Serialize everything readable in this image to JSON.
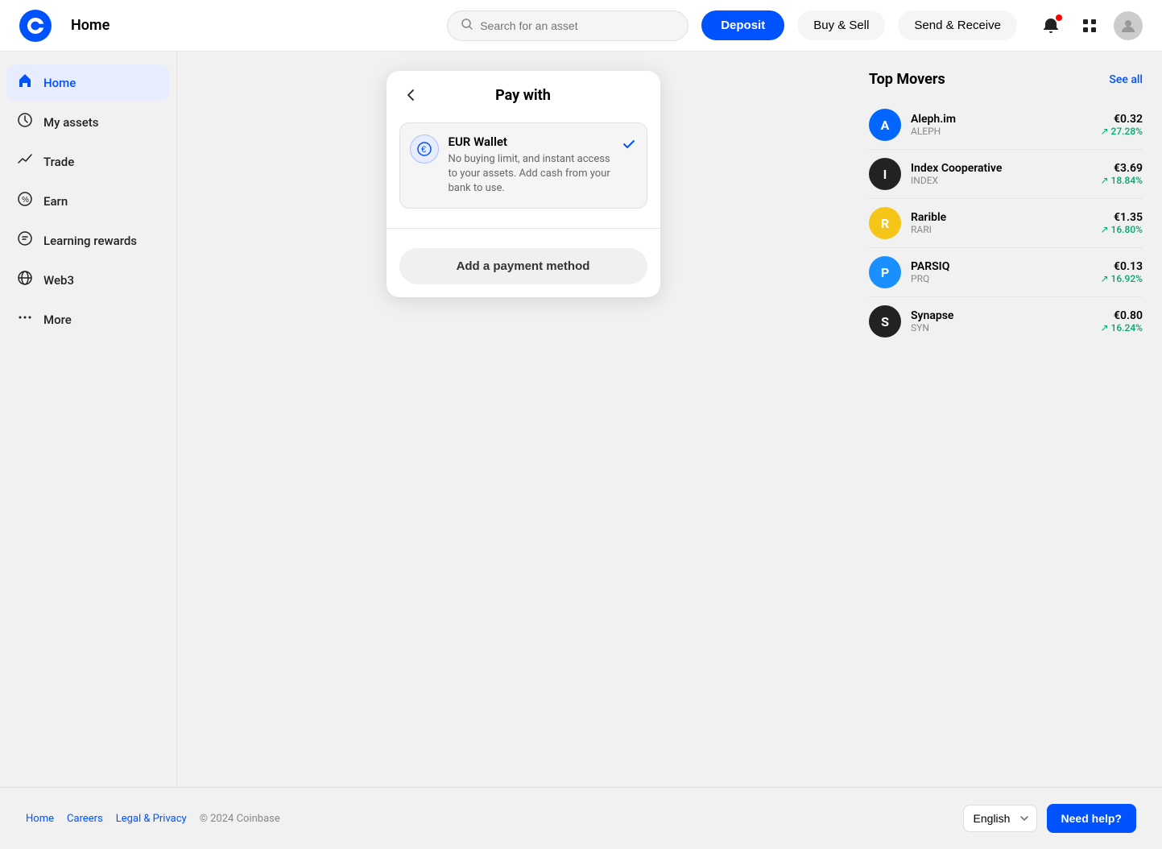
{
  "topnav": {
    "title": "Home",
    "search_placeholder": "Search for an asset",
    "deposit_label": "Deposit",
    "buy_sell_label": "Buy & Sell",
    "send_receive_label": "Send & Receive"
  },
  "sidebar": {
    "items": [
      {
        "id": "home",
        "label": "Home",
        "icon": "🏠",
        "active": true
      },
      {
        "id": "my-assets",
        "label": "My assets",
        "icon": "⏱"
      },
      {
        "id": "trade",
        "label": "Trade",
        "icon": "📈"
      },
      {
        "id": "earn",
        "label": "Earn",
        "icon": "%"
      },
      {
        "id": "learning-rewards",
        "label": "Learning rewards",
        "icon": "🎓"
      },
      {
        "id": "web3",
        "label": "Web3",
        "icon": "🌐"
      },
      {
        "id": "more",
        "label": "More",
        "icon": "⋯"
      }
    ]
  },
  "modal": {
    "title": "Pay with",
    "payment_option": {
      "name": "EUR Wallet",
      "description": "No buying limit, and instant access to your assets. Add cash from your bank to use.",
      "selected": true
    },
    "add_payment_label": "Add a payment method"
  },
  "top_movers": {
    "title": "Top Movers",
    "see_all_label": "See all",
    "items": [
      {
        "name": "Aleph.im",
        "symbol": "ALEPH",
        "price": "€0.32",
        "change": "↗ 27.28%",
        "color": "#0066ff"
      },
      {
        "name": "Index Cooperative",
        "symbol": "INDEX",
        "price": "€3.69",
        "change": "↗ 18.84%",
        "color": "#222"
      },
      {
        "name": "Rarible",
        "symbol": "RARI",
        "price": "€1.35",
        "change": "↗ 16.80%",
        "color": "#f5c518"
      },
      {
        "name": "PARSIQ",
        "symbol": "PRQ",
        "price": "€0.13",
        "change": "↗ 16.92%",
        "color": "#1a8fff"
      },
      {
        "name": "Synapse",
        "symbol": "SYN",
        "price": "€0.80",
        "change": "↗ 16.24%",
        "color": "#222"
      }
    ]
  },
  "footer": {
    "links": [
      {
        "label": "Home"
      },
      {
        "label": "Careers"
      },
      {
        "label": "Legal & Privacy"
      }
    ],
    "copyright": "© 2024 Coinbase",
    "language_label": "English",
    "need_help_label": "Need help?"
  }
}
